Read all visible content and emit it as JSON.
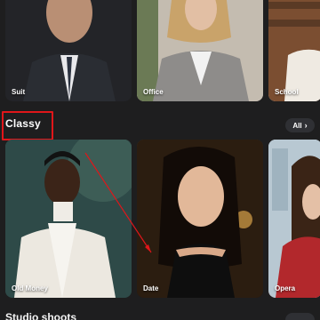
{
  "top_row": {
    "cards": [
      {
        "label": "Suit"
      },
      {
        "label": "Office"
      },
      {
        "label": "School"
      }
    ]
  },
  "section_classy": {
    "title": "Classy",
    "all_label": "All",
    "cards": [
      {
        "label": "Old Money"
      },
      {
        "label": "Date"
      },
      {
        "label": "Opera"
      }
    ]
  },
  "next_section": {
    "title": "Studio shoots"
  },
  "colors": {
    "background": "#1e1e1f",
    "highlight": "#e0161a",
    "pill": "#2f3034"
  },
  "icons": {
    "all_chevron": "chevron-right-icon"
  }
}
